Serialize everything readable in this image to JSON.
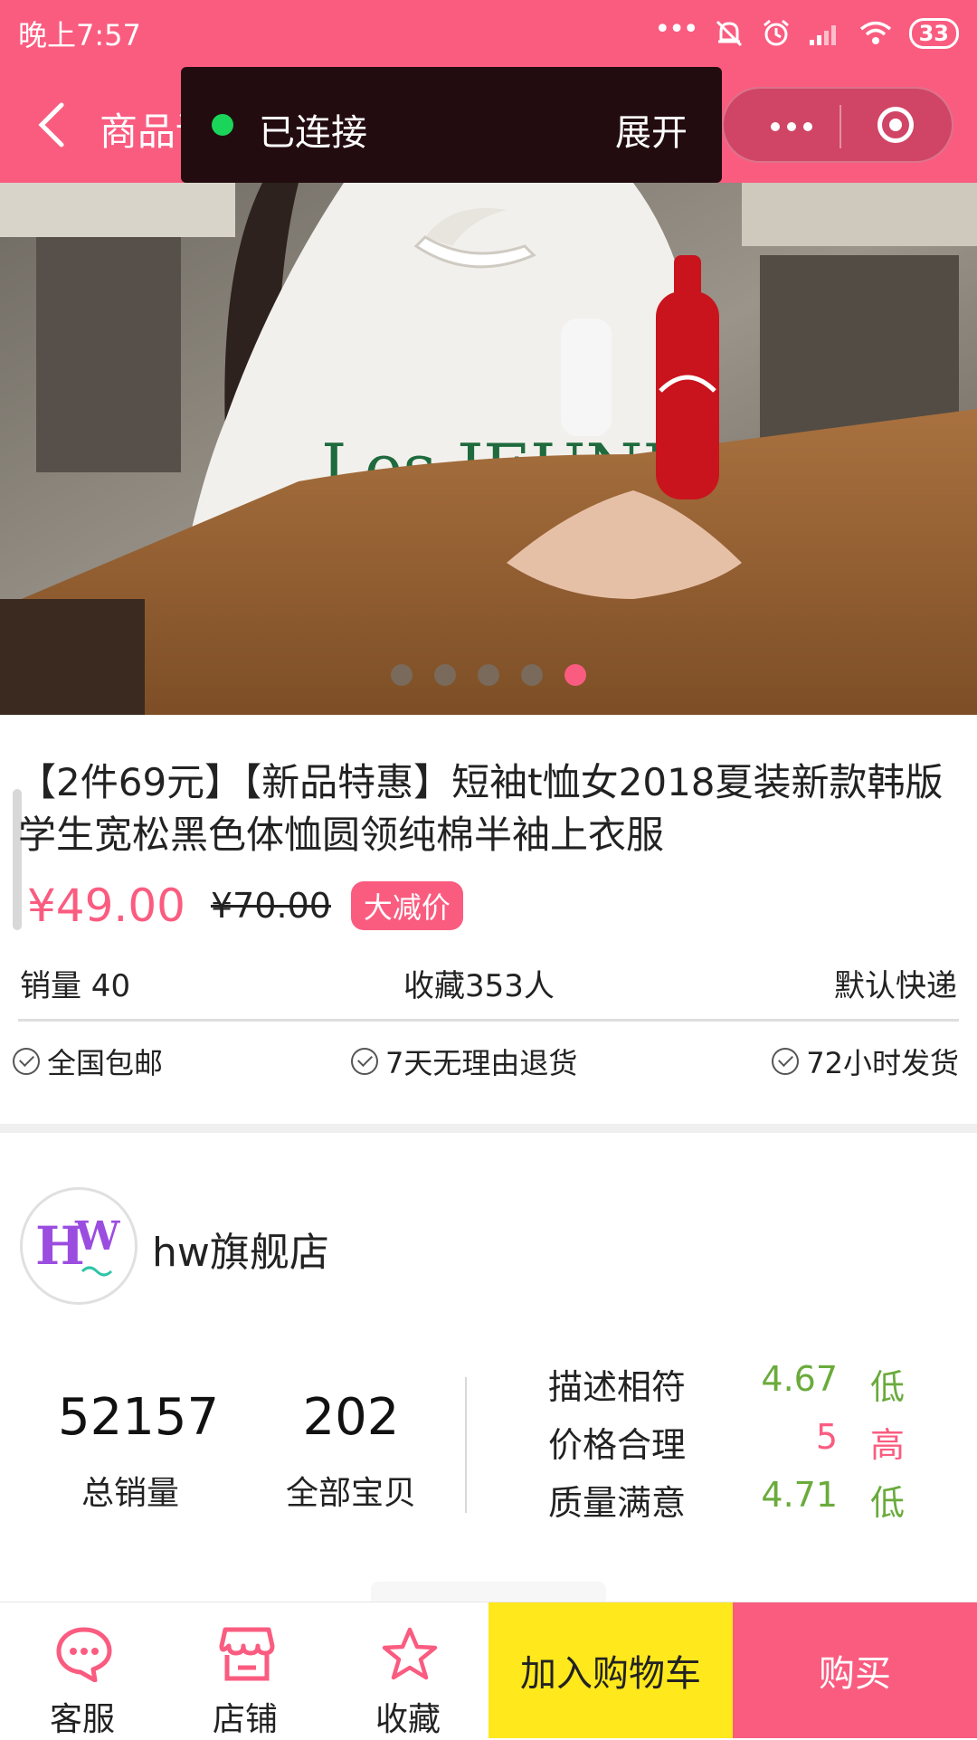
{
  "status_bar": {
    "time": "晚上7:57",
    "battery": "33"
  },
  "nav": {
    "title": "商品详情"
  },
  "connection_toast": {
    "status": "已连接",
    "expand": "展开"
  },
  "carousel": {
    "slide_count": 5,
    "active_index": 4
  },
  "product": {
    "title": "【2件69元】【新品特惠】短袖t恤女2018夏装新款韩版学生宽松黑色体恤圆领纯棉半袖上衣服",
    "price": "¥49.00",
    "original_price": "¥70.00",
    "badge": "大减价",
    "sales": "销量 40",
    "favorites": "收藏353人",
    "shipping": "默认快递",
    "services": [
      "全国包邮",
      "7天无理由退货",
      "72小时发货"
    ]
  },
  "shop": {
    "name": "hw旗舰店",
    "stats": [
      {
        "value": "52157",
        "label": "总销量"
      },
      {
        "value": "202",
        "label": "全部宝贝"
      }
    ],
    "scores": [
      {
        "label": "描述相符",
        "value": "4.67",
        "level": "低",
        "color": "#6aab3c"
      },
      {
        "label": "价格合理",
        "value": "5",
        "level": "高",
        "color": "#fa5c80"
      },
      {
        "label": "质量满意",
        "value": "4.71",
        "level": "低",
        "color": "#6aab3c"
      }
    ]
  },
  "bottom_bar": {
    "service": "客服",
    "shop": "店铺",
    "favorite": "收藏",
    "add_to_cart": "加入购物车",
    "buy": "购买"
  },
  "colors": {
    "primary": "#fa5c80",
    "cart": "#ffe81c",
    "score_low": "#6aab3c"
  }
}
